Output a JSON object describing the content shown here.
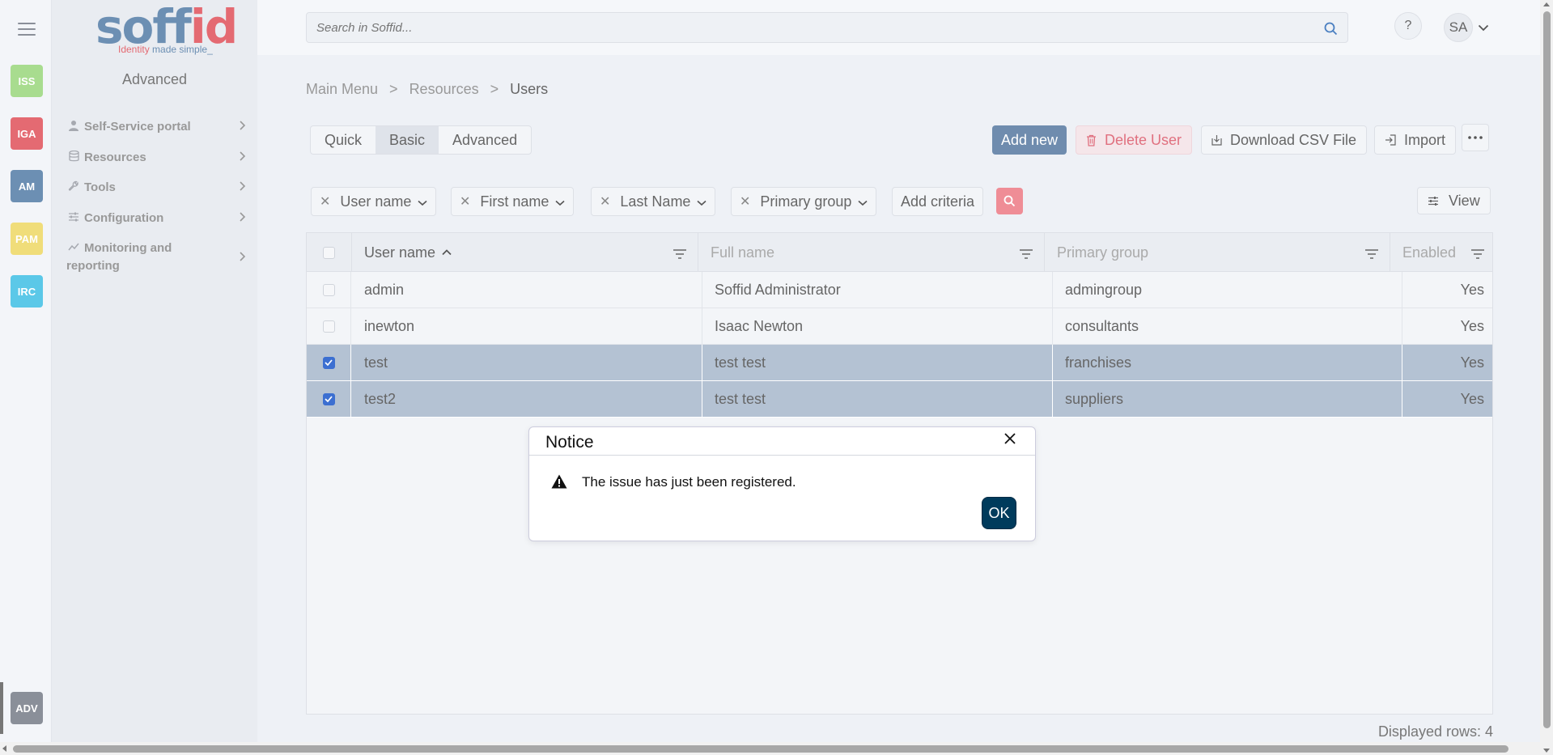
{
  "rail": {
    "items": [
      {
        "label": "ISS",
        "color": "#a8dc8f"
      },
      {
        "label": "IGA",
        "color": "#e46a72"
      },
      {
        "label": "AM",
        "color": "#6c8fb3"
      },
      {
        "label": "PAM",
        "color": "#f0dd7a"
      },
      {
        "label": "IRC",
        "color": "#5bc8e8"
      }
    ],
    "active": {
      "label": "ADV",
      "color": "#8a8f99"
    }
  },
  "logo": {
    "word_main": "soff",
    "word_accent": "id",
    "tag_accent": "Identity",
    "tag_rest": " made simple_"
  },
  "sidebar": {
    "title": "Advanced",
    "items": [
      {
        "label": "Self-Service portal",
        "icon": "user-icon"
      },
      {
        "label": "Resources",
        "icon": "database-icon"
      },
      {
        "label": "Tools",
        "icon": "wrench-icon"
      },
      {
        "label": "Configuration",
        "icon": "sliders-icon"
      },
      {
        "label": "Monitoring and reporting",
        "icon": "chart-icon"
      }
    ]
  },
  "topbar": {
    "search_placeholder": "Search in Soffid...",
    "help_label": "?",
    "user_initials": "SA"
  },
  "breadcrumb": {
    "items": [
      "Main Menu",
      "Resources",
      "Users"
    ],
    "separator": ">"
  },
  "tabs": {
    "items": [
      "Quick",
      "Basic",
      "Advanced"
    ],
    "active": "Basic"
  },
  "actions": {
    "add_new": "Add new",
    "delete": "Delete User",
    "csv": "Download CSV File",
    "import": "Import",
    "more": "..."
  },
  "filters": {
    "chips": [
      "User name",
      "First name",
      "Last Name",
      "Primary group"
    ],
    "add_criteria": "Add criteria",
    "view": "View"
  },
  "table": {
    "columns": [
      "User name",
      "Full name",
      "Primary group",
      "Enabled"
    ],
    "rows": [
      {
        "user": "admin",
        "full": "Soffid Administrator",
        "group": "admingroup",
        "enabled": "Yes",
        "selected": false
      },
      {
        "user": "inewton",
        "full": "Isaac Newton",
        "group": "consultants",
        "enabled": "Yes",
        "selected": false
      },
      {
        "user": "test",
        "full": "test test",
        "group": "franchises",
        "enabled": "Yes",
        "selected": true
      },
      {
        "user": "test2",
        "full": "test test",
        "group": "suppliers",
        "enabled": "Yes",
        "selected": true
      }
    ],
    "displayed": "Displayed rows: 4"
  },
  "modal": {
    "title": "Notice",
    "message": "The issue has just been registered.",
    "ok": "OK"
  },
  "colors": {
    "accent": "#6f8cae",
    "danger": "#e0707f",
    "selected_row": "#b4c2d3",
    "modal_button": "#003b5c"
  }
}
